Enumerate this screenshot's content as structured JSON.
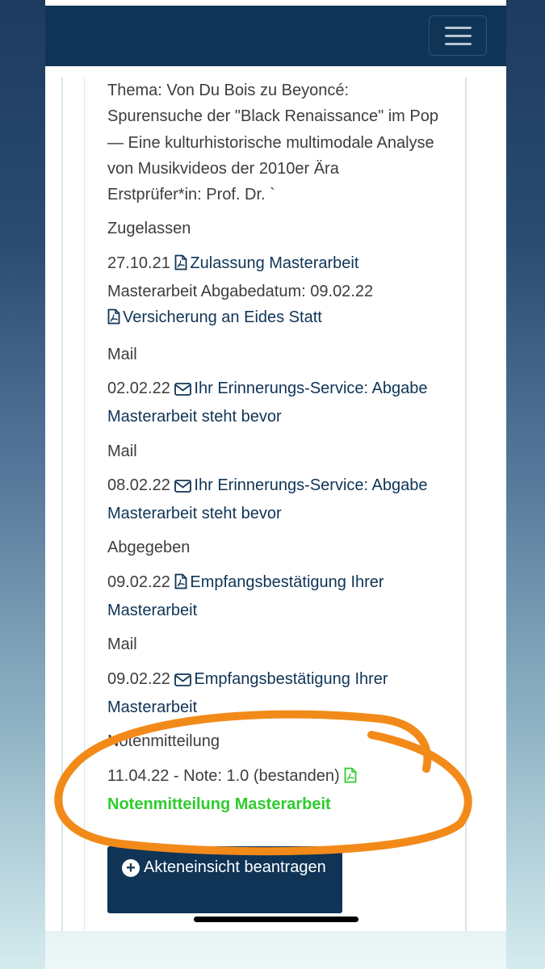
{
  "header": {
    "menu_icon": "hamburger-menu-icon"
  },
  "thesis": {
    "title": "Thema: Von Du Bois zu Beyoncé: Spurensuche der \"Black Renaissance\" im Pop — Eine kulturhistorische multimodale Analyse von Musikvideos der 2010er Ära",
    "examiner": "Erstprüfer*in: Prof. Dr. `"
  },
  "entries": [
    {
      "label": "Zugelassen",
      "date": "27.10.21",
      "icon": "pdf-file-icon",
      "link": "Zulassung Masterarbeit",
      "extra_text": "Masterarbeit Abgabedatum: 09.02.22",
      "extra_icon": "pdf-file-icon",
      "extra_link": "Versicherung an Eides Statt"
    },
    {
      "label": "Mail",
      "date": "02.02.22",
      "icon": "envelope-icon",
      "link": "Ihr Erinnerungs-Service: Abgabe Masterarbeit steht bevor"
    },
    {
      "label": "Mail",
      "date": "08.02.22",
      "icon": "envelope-icon",
      "link": "Ihr Erinnerungs-Service: Abgabe Masterarbeit steht bevor"
    },
    {
      "label": "Abgegeben",
      "date": "09.02.22",
      "icon": "pdf-file-icon",
      "link": "Empfangsbestätigung Ihrer Masterarbeit"
    },
    {
      "label": "Mail",
      "date": "09.02.22",
      "icon": "envelope-icon",
      "link": "Empfangsbestätigung Ihrer Masterarbeit"
    },
    {
      "label": "Notenmitteilung",
      "text": "11.04.22 - Note: 1.0 (bestanden)",
      "icon": "pdf-file-icon",
      "link": "Notenmitteilung Masterarbeit"
    }
  ],
  "action_button": {
    "icon": "plus-circle-icon",
    "label": "Akteneinsicht beantragen"
  },
  "colors": {
    "navbar": "#0f3456",
    "link": "#0f3456",
    "success_link": "#2ecc2e",
    "annotation": "#f28a1a"
  }
}
